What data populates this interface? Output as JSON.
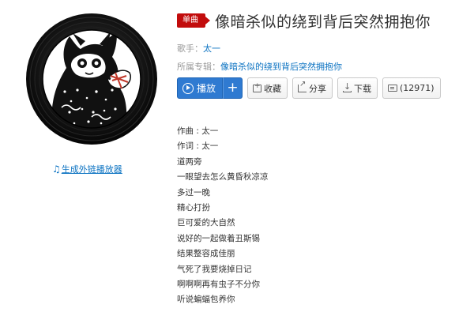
{
  "colors": {
    "accent": "#c20c0c",
    "link": "#0c73c2",
    "play": "#2f7ad1"
  },
  "song": {
    "badge": "单曲",
    "title": "像暗杀似的绕到背后突然拥抱你",
    "artist_label": "歌手：",
    "artist": "太一",
    "album_label": "所属专辑：",
    "album": "像暗杀似的绕到背后突然拥抱你"
  },
  "cover": {
    "icon": "vinyl-record-cat-illustration"
  },
  "outer_link": {
    "icon": "music-note-icon",
    "label": "生成外链播放器"
  },
  "toolbar": {
    "play_label": "播放",
    "add_label": "+",
    "collect_label": "收藏",
    "share_label": "分享",
    "download_label": "下载",
    "comment_label": "(12971)"
  },
  "lyrics": [
    "作曲 : 太一",
    "作词 : 太一",
    "道两旁",
    "一眼望去怎么黄昏秋凉凉",
    "多过一晚",
    "精心打扮",
    "巨可爱的大自然",
    "说好的一起做着丑斯锡",
    "结果整容成佳丽",
    "气死了我要烧掉日记",
    "啊啊啊再有虫子不分你",
    "听说蝙蝠包养你"
  ]
}
